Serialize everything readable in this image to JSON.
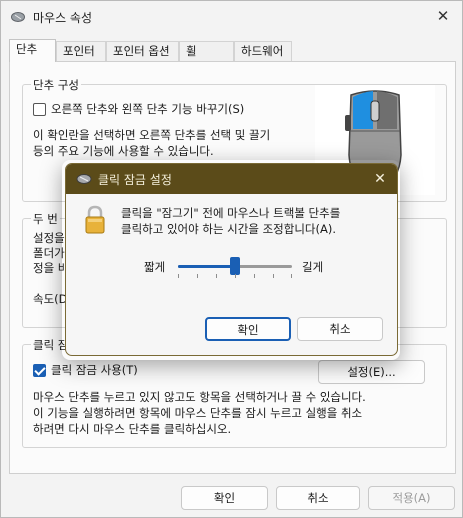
{
  "window": {
    "title": "마우스 속성",
    "close_glyph": "✕"
  },
  "tabs": [
    {
      "label": "단추",
      "active": true
    },
    {
      "label": "포인터",
      "active": false
    },
    {
      "label": "포인터 옵션",
      "active": false
    },
    {
      "label": "휠",
      "active": false
    },
    {
      "label": "하드웨어",
      "active": false
    }
  ],
  "button_config": {
    "group_title": "단추 구성",
    "swap_checkbox_label": "오른쪽 단추와 왼쪽 단추 기능 바꾸기(S)",
    "swap_checked": false,
    "description_line1": "이 확인란을 선택하면 오른쪽 단추를 선택 및 끌기",
    "description_line2": "등의 주요 기능에 사용할 수 있습니다."
  },
  "double_click": {
    "group_title_partial": "두 번",
    "desc_fragment_1": "설정을",
    "desc_fragment_2": "폴더가",
    "desc_fragment_3": "정을 바",
    "speed_label_partial": "속도(D"
  },
  "click_lock": {
    "group_title_partial": "클릭 잠",
    "checkbox_label": "클릭 잠금 사용(T)",
    "checked": true,
    "settings_button": "설정(E)...",
    "description_line1": "마우스 단추를 누르고 있지 않고도 항목을 선택하거나 끌 수 있습니다.",
    "description_line2": "이 기능을 실행하려면 항목에 마우스 단추를 잠시 누르고 실행을 취소",
    "description_line3": "하려면 다시 마우스 단추를 클릭하십시오."
  },
  "footer": {
    "ok": "확인",
    "cancel": "취소",
    "apply": "적용(A)"
  },
  "dialog": {
    "title": "클릭 잠금 설정",
    "close_glyph": "✕",
    "message_line1": "클릭을 \"잠그기\" 전에 마우스나 트랙볼 단추를",
    "message_line2": "클릭하고 있어야 하는 시간을 조정합니다(A).",
    "slider_min_label": "짧게",
    "slider_max_label": "길게",
    "slider_value_fraction": 0.5,
    "ok": "확인",
    "cancel": "취소"
  },
  "colors": {
    "accent": "#1a5fb4",
    "dialog_titlebar": "#5b4b19",
    "lock_icon": "#e8b23a"
  },
  "icons": {
    "window": "mouse-app-icon",
    "dialog": "mouse-app-icon",
    "lock": "padlock-icon"
  }
}
